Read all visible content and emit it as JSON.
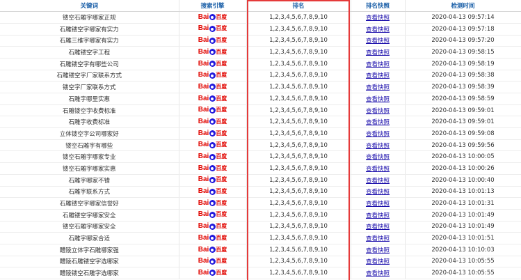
{
  "headers": {
    "keyword": "关键词",
    "engine": "搜索引擎",
    "rank": "排名",
    "snapshot": "排名快照",
    "time": "检测时间"
  },
  "logo": {
    "bai": "Bai",
    "du": "百度"
  },
  "colors": {
    "header_text": "#1a5fa8",
    "highlight_frame": "#e53a3a",
    "baidu_red": "#e10601",
    "baidu_blue": "#2319dc"
  },
  "rows": [
    {
      "keyword": "镂空石雕字哪家正规",
      "rank": "1,2,3,4,5,6,7,8,9,10",
      "snapshot": "查看快照",
      "time": "2020-04-13 09:57:14"
    },
    {
      "keyword": "石雕镂空字哪家有实力",
      "rank": "1,2,3,4,5,6,7,8,9,10",
      "snapshot": "查看快照",
      "time": "2020-04-13 09:57:18"
    },
    {
      "keyword": "石雕三维字哪家有实力",
      "rank": "1,2,3,4,5,6,7,8,9,10",
      "snapshot": "查看快照",
      "time": "2020-04-13 09:57:20"
    },
    {
      "keyword": "石雕镂空字工程",
      "rank": "1,2,3,4,5,6,7,8,9,10",
      "snapshot": "查看快照",
      "time": "2020-04-13 09:58:15"
    },
    {
      "keyword": "石雕镂空字有哪些公司",
      "rank": "1,2,3,4,5,6,7,8,9,10",
      "snapshot": "查看快照",
      "time": "2020-04-13 09:58:19"
    },
    {
      "keyword": "石雕镂空字厂家联系方式",
      "rank": "1,2,3,4,5,6,7,8,9,10",
      "snapshot": "查看快照",
      "time": "2020-04-13 09:58:38"
    },
    {
      "keyword": "镂空字厂家联系方式",
      "rank": "1,2,3,4,5,6,7,8,9,10",
      "snapshot": "查看快照",
      "time": "2020-04-13 09:58:39"
    },
    {
      "keyword": "石雕字哪里实惠",
      "rank": "1,2,3,4,5,6,7,8,9,10",
      "snapshot": "查看快照",
      "time": "2020-04-13 09:58:59"
    },
    {
      "keyword": "石雕镂空字收费标准",
      "rank": "1,2,3,4,5,6,7,8,9,10",
      "snapshot": "查看快照",
      "time": "2020-04-13 09:59:01"
    },
    {
      "keyword": "石雕字收费标准",
      "rank": "1,2,3,4,5,6,7,8,9,10",
      "snapshot": "查看快照",
      "time": "2020-04-13 09:59:01"
    },
    {
      "keyword": "立体镂空字公司哪家好",
      "rank": "1,2,3,4,5,6,7,8,9,10",
      "snapshot": "查看快照",
      "time": "2020-04-13 09:59:08"
    },
    {
      "keyword": "镂空石雕字有哪些",
      "rank": "1,2,3,4,5,6,7,8,9,10",
      "snapshot": "查看快照",
      "time": "2020-04-13 09:59:56"
    },
    {
      "keyword": "镂空石雕字哪家专业",
      "rank": "1,2,3,4,5,6,7,8,9,10",
      "snapshot": "查看快照",
      "time": "2020-04-13 10:00:05"
    },
    {
      "keyword": "镂空石雕字哪家实惠",
      "rank": "1,2,3,4,5,6,7,8,9,10",
      "snapshot": "查看快照",
      "time": "2020-04-13 10:00:26"
    },
    {
      "keyword": "石雕字哪家不错",
      "rank": "1,2,3,4,5,6,7,8,9,10",
      "snapshot": "查看快照",
      "time": "2020-04-13 10:00:40"
    },
    {
      "keyword": "石雕字联系方式",
      "rank": "1,2,3,4,5,6,7,8,9,10",
      "snapshot": "查看快照",
      "time": "2020-04-13 10:01:13"
    },
    {
      "keyword": "石雕镂空字哪家信誉好",
      "rank": "1,2,3,4,5,6,7,8,9,10",
      "snapshot": "查看快照",
      "time": "2020-04-13 10:01:31"
    },
    {
      "keyword": "石雕镂空字哪家安全",
      "rank": "1,2,3,4,5,6,7,8,9,10",
      "snapshot": "查看快照",
      "time": "2020-04-13 10:01:49"
    },
    {
      "keyword": "镂空石雕字哪家安全",
      "rank": "1,2,3,4,5,6,7,8,9,10",
      "snapshot": "查看快照",
      "time": "2020-04-13 10:01:49"
    },
    {
      "keyword": "石雕字哪家合适",
      "rank": "1,2,3,4,5,6,7,8,9,10",
      "snapshot": "查看快照",
      "time": "2020-04-13 10:01:51"
    },
    {
      "keyword": "醴陵立体字石雕哪家强",
      "rank": "1,2,3,4,5,6,7,8,9,10",
      "snapshot": "查看快照",
      "time": "2020-04-13 10:10:03"
    },
    {
      "keyword": "醴陵石雕镂空字选哪家",
      "rank": "1,2,3,4,5,6,7,8,9,10",
      "snapshot": "查看快照",
      "time": "2020-04-13 10:05:55"
    },
    {
      "keyword": "醴陵镂空石雕字选哪家",
      "rank": "1,2,3,4,5,6,7,8,9,10",
      "snapshot": "查看快照",
      "time": "2020-04-13 10:05:55"
    }
  ]
}
